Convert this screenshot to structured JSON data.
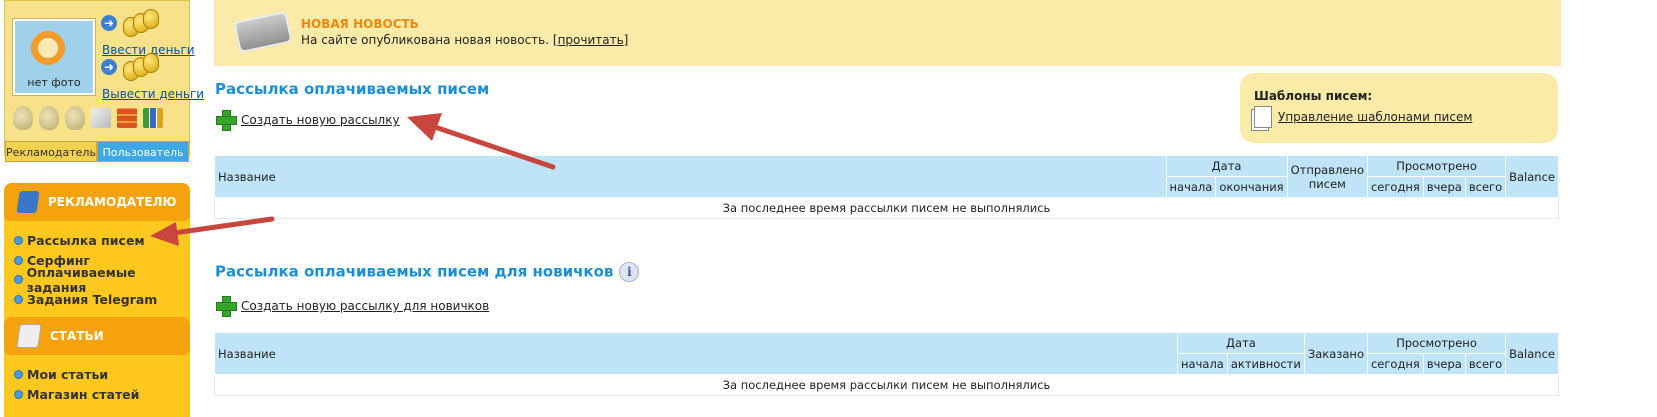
{
  "user": {
    "no_photo": "нет фото",
    "deposit_link": "Ввести деньги",
    "withdraw_link": "Вывести деньги",
    "role_tabs": [
      "Рекламодатель",
      "Пользователь"
    ]
  },
  "menu": {
    "advertiser_header": "РЕКЛАМОДАТЕЛЮ",
    "advertiser_items": [
      "Рассылка писем",
      "Серфинг",
      "Оплачиваемые задания",
      "Задания Telegram"
    ],
    "articles_header": "СТАТЬИ",
    "articles_items": [
      "Мои статьи",
      "Магазин статей"
    ]
  },
  "news": {
    "title": "НОВАЯ НОВОСТЬ",
    "text": "На сайте опубликована новая новость.",
    "link_bracket_open": "[",
    "link": "прочитать",
    "link_bracket_close": "]"
  },
  "paid": {
    "heading": "Рассылка оплачиваемых писем",
    "create_link": "Создать новую рассылку",
    "table": {
      "col_name": "Название",
      "col_date": "Дата",
      "col_start": "начала",
      "col_end": "окончания",
      "col_sent_1": "Отправлено",
      "col_sent_2": "писем",
      "col_viewed": "Просмотрено",
      "col_today": "сегодня",
      "col_yesterday": "вчера",
      "col_total": "всего",
      "col_balance": "Balance",
      "empty": "За последнее время рассылки писем не выполнялись"
    }
  },
  "templates": {
    "title": "Шаблоны писем:",
    "link": "Управление шаблонами писем"
  },
  "newbies": {
    "heading": "Рассылка оплачиваемых писем для новичков",
    "info_icon": "i",
    "create_link": "Создать новую рассылку для новичков",
    "table": {
      "col_name": "Название",
      "col_date": "Дата",
      "col_start": "начала",
      "col_activity": "активности",
      "col_ordered": "Заказано",
      "col_viewed": "Просмотрено",
      "col_today": "сегодня",
      "col_yesterday": "вчера",
      "col_total": "всего",
      "col_balance": "Balance",
      "empty": "За последнее время рассылки писем не выполнялись"
    }
  },
  "colors": {
    "heading": "#1a8fd6",
    "menu_bg": "#ffc81f",
    "news_bg": "#faeca8",
    "table_head": "#bfe3f7",
    "annotation_arrow": "#c9463d"
  }
}
